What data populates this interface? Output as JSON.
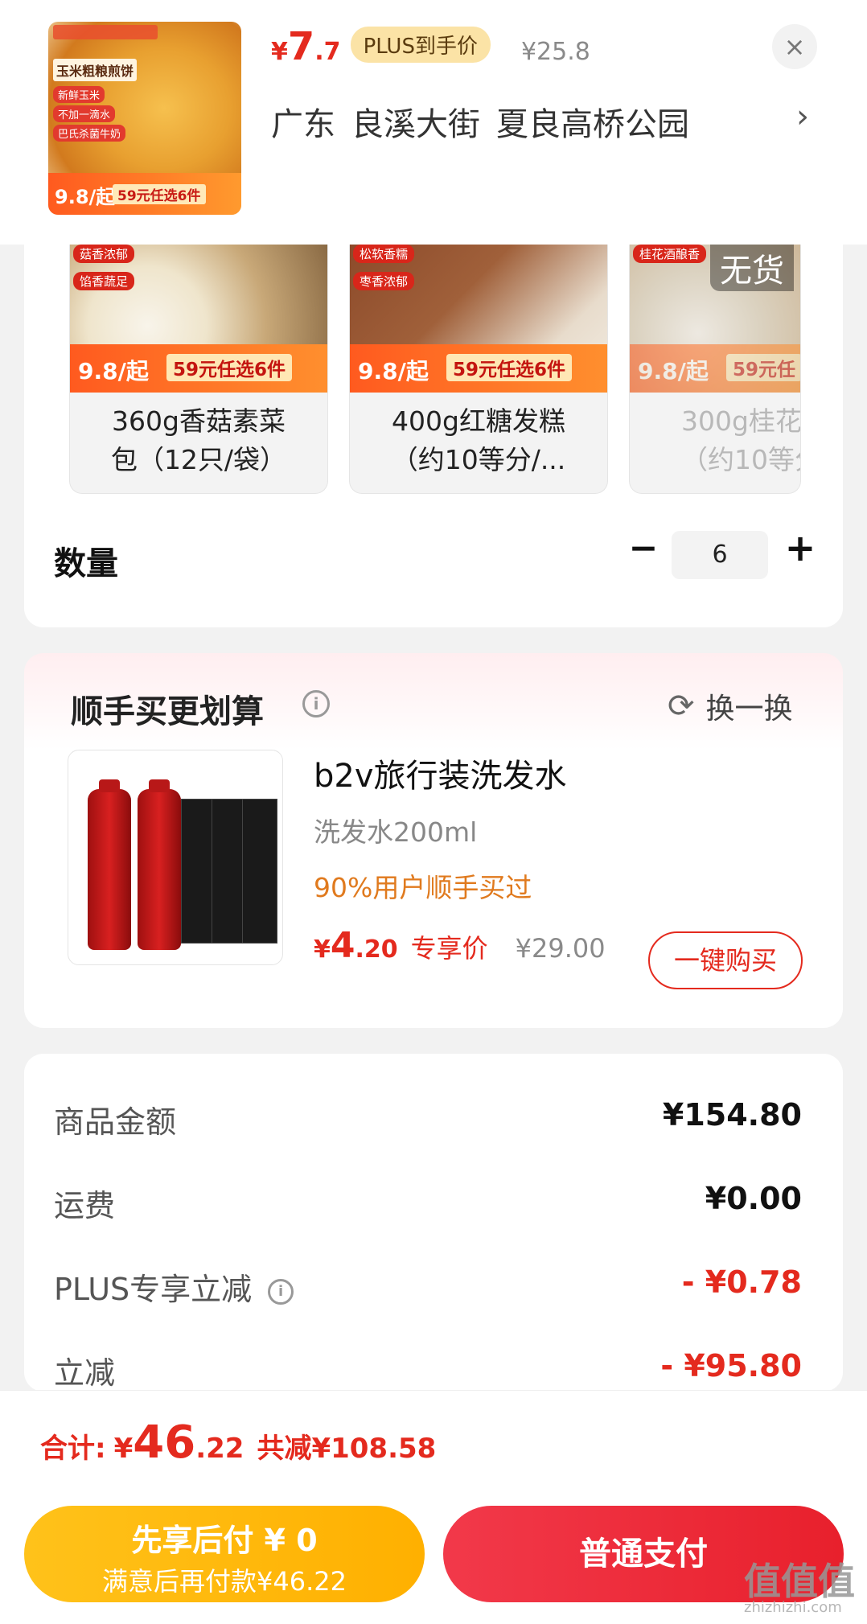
{
  "header": {
    "main_thumb": {
      "title": "玉米粗粮煎饼",
      "tags": [
        "新鲜玉米",
        "不加一滴水",
        "巴氏杀菌牛奶"
      ],
      "price_badge": "9.8/起",
      "promo": "59元任选6件"
    },
    "price": {
      "currency": "¥",
      "integer": "7",
      "decimal": ".7"
    },
    "plus_badge": "PLUS到手价",
    "original_price": "¥25.8",
    "close_icon": "×",
    "address": {
      "province": "广东",
      "street": "良溪大街",
      "place": "夏良高桥公园"
    },
    "address_chevron": "›"
  },
  "variants": [
    {
      "tags": [
        "菇香浓郁",
        "馅香蔬足"
      ],
      "price": "9.8/起",
      "promo": "59元任选6件",
      "name_line1": "360g香菇素菜",
      "name_line2": "包（12只/袋）"
    },
    {
      "tags": [
        "松软香糯",
        "枣香浓郁"
      ],
      "price": "9.8/起",
      "promo": "59元任选6件",
      "name_line1": "400g红糖发糕",
      "name_line2": "（约10等分/..."
    },
    {
      "tags": [
        "桂花酒酿香"
      ],
      "price": "9.8/起",
      "promo": "59元任",
      "name_line1": "300g桂花",
      "name_line2": "（约10等分",
      "stock": "无货"
    }
  ],
  "quantity": {
    "label": "数量",
    "minus": "−",
    "value": "6",
    "plus": "+"
  },
  "addon": {
    "title": "顺手买更划算",
    "info_icon": "i",
    "refresh_label": "换一换",
    "product": {
      "name": "b2v旅行装洗发水",
      "spec": "洗发水200ml",
      "social": "90%用户顺手买过",
      "price_currency": "¥",
      "price_integer": "4",
      "price_decimal": ".20",
      "price_label": "专享价",
      "original_price": "¥29.00",
      "buy_label": "一键购买"
    }
  },
  "fees": [
    {
      "label": "商品金额",
      "value": "¥154.80",
      "red": false
    },
    {
      "label": "运费",
      "value": "¥0.00",
      "red": false
    },
    {
      "label": "PLUS专享立减",
      "value": "- ¥0.78",
      "red": true,
      "info": "i"
    },
    {
      "label": "立减",
      "value": "- ¥95.80",
      "red": true
    }
  ],
  "total": {
    "label": "合计:",
    "currency": "¥",
    "integer": "46",
    "decimal": ".22",
    "saving": "共减¥108.58"
  },
  "actions": {
    "pay_later_line1": "先享后付 ¥ 0",
    "pay_later_line2": "满意后再付款¥46.22",
    "pay_normal": "普通支付"
  },
  "watermark": {
    "text": "值值值",
    "sub": "zhizhizhi.com"
  },
  "colors": {
    "accent_red": "#e42a1e",
    "plus_gold": "#fbe3a6",
    "pay_later_yellow": "#ffb000",
    "social_orange": "#e07a1e"
  }
}
